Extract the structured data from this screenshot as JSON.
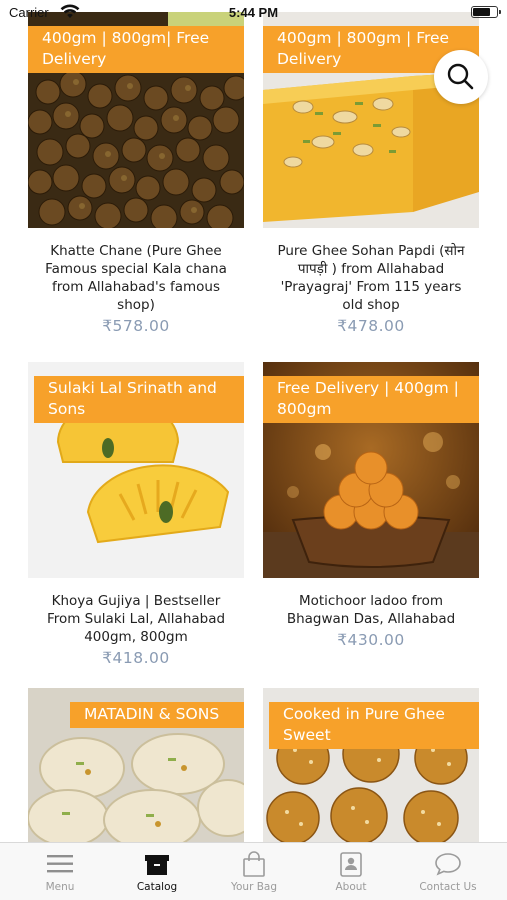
{
  "status_bar": {
    "carrier": "Carrier",
    "time": "5:44 PM"
  },
  "products": [
    {
      "badge": "400gm | 800gm| Free Delivery",
      "title": "Khatte Chane (Pure Ghee Famous special Kala chana from Allahabad's famous shop)",
      "price": "₹578.00"
    },
    {
      "badge": "400gm | 800gm | Free Delivery",
      "title": "Pure Ghee Sohan Papdi (सोन पापड़ी ) from Allahabad 'Prayagraj' From 115 years old shop",
      "price": "₹478.00"
    },
    {
      "badge": "Sulaki Lal Srinath and Sons",
      "title": "Khoya Gujiya | Bestseller From Sulaki Lal, Allahabad 400gm, 800gm",
      "price": "₹418.00"
    },
    {
      "badge": "Free Delivery | 400gm | 800gm",
      "title": "Motichoor ladoo from Bhagwan Das, Allahabad",
      "price": "₹430.00"
    },
    {
      "badge": "MATADIN & SONS",
      "title": "",
      "price": ""
    },
    {
      "badge": "Cooked in Pure Ghee Sweet",
      "title": "",
      "price": ""
    }
  ],
  "search_fab": {
    "icon": "search-icon"
  },
  "tabbar": {
    "tabs": [
      {
        "label": "Menu",
        "icon": "menu-icon",
        "active": false
      },
      {
        "label": "Catalog",
        "icon": "catalog-icon",
        "active": true
      },
      {
        "label": "Your Bag",
        "icon": "bag-icon",
        "active": false
      },
      {
        "label": "About",
        "icon": "about-icon",
        "active": false
      },
      {
        "label": "Contact Us",
        "icon": "chat-icon",
        "active": false
      }
    ]
  },
  "colors": {
    "badge": "#f7a12a",
    "price": "#8a9bb3",
    "tab_inactive": "#9b9b9b",
    "tab_active": "#111111"
  }
}
